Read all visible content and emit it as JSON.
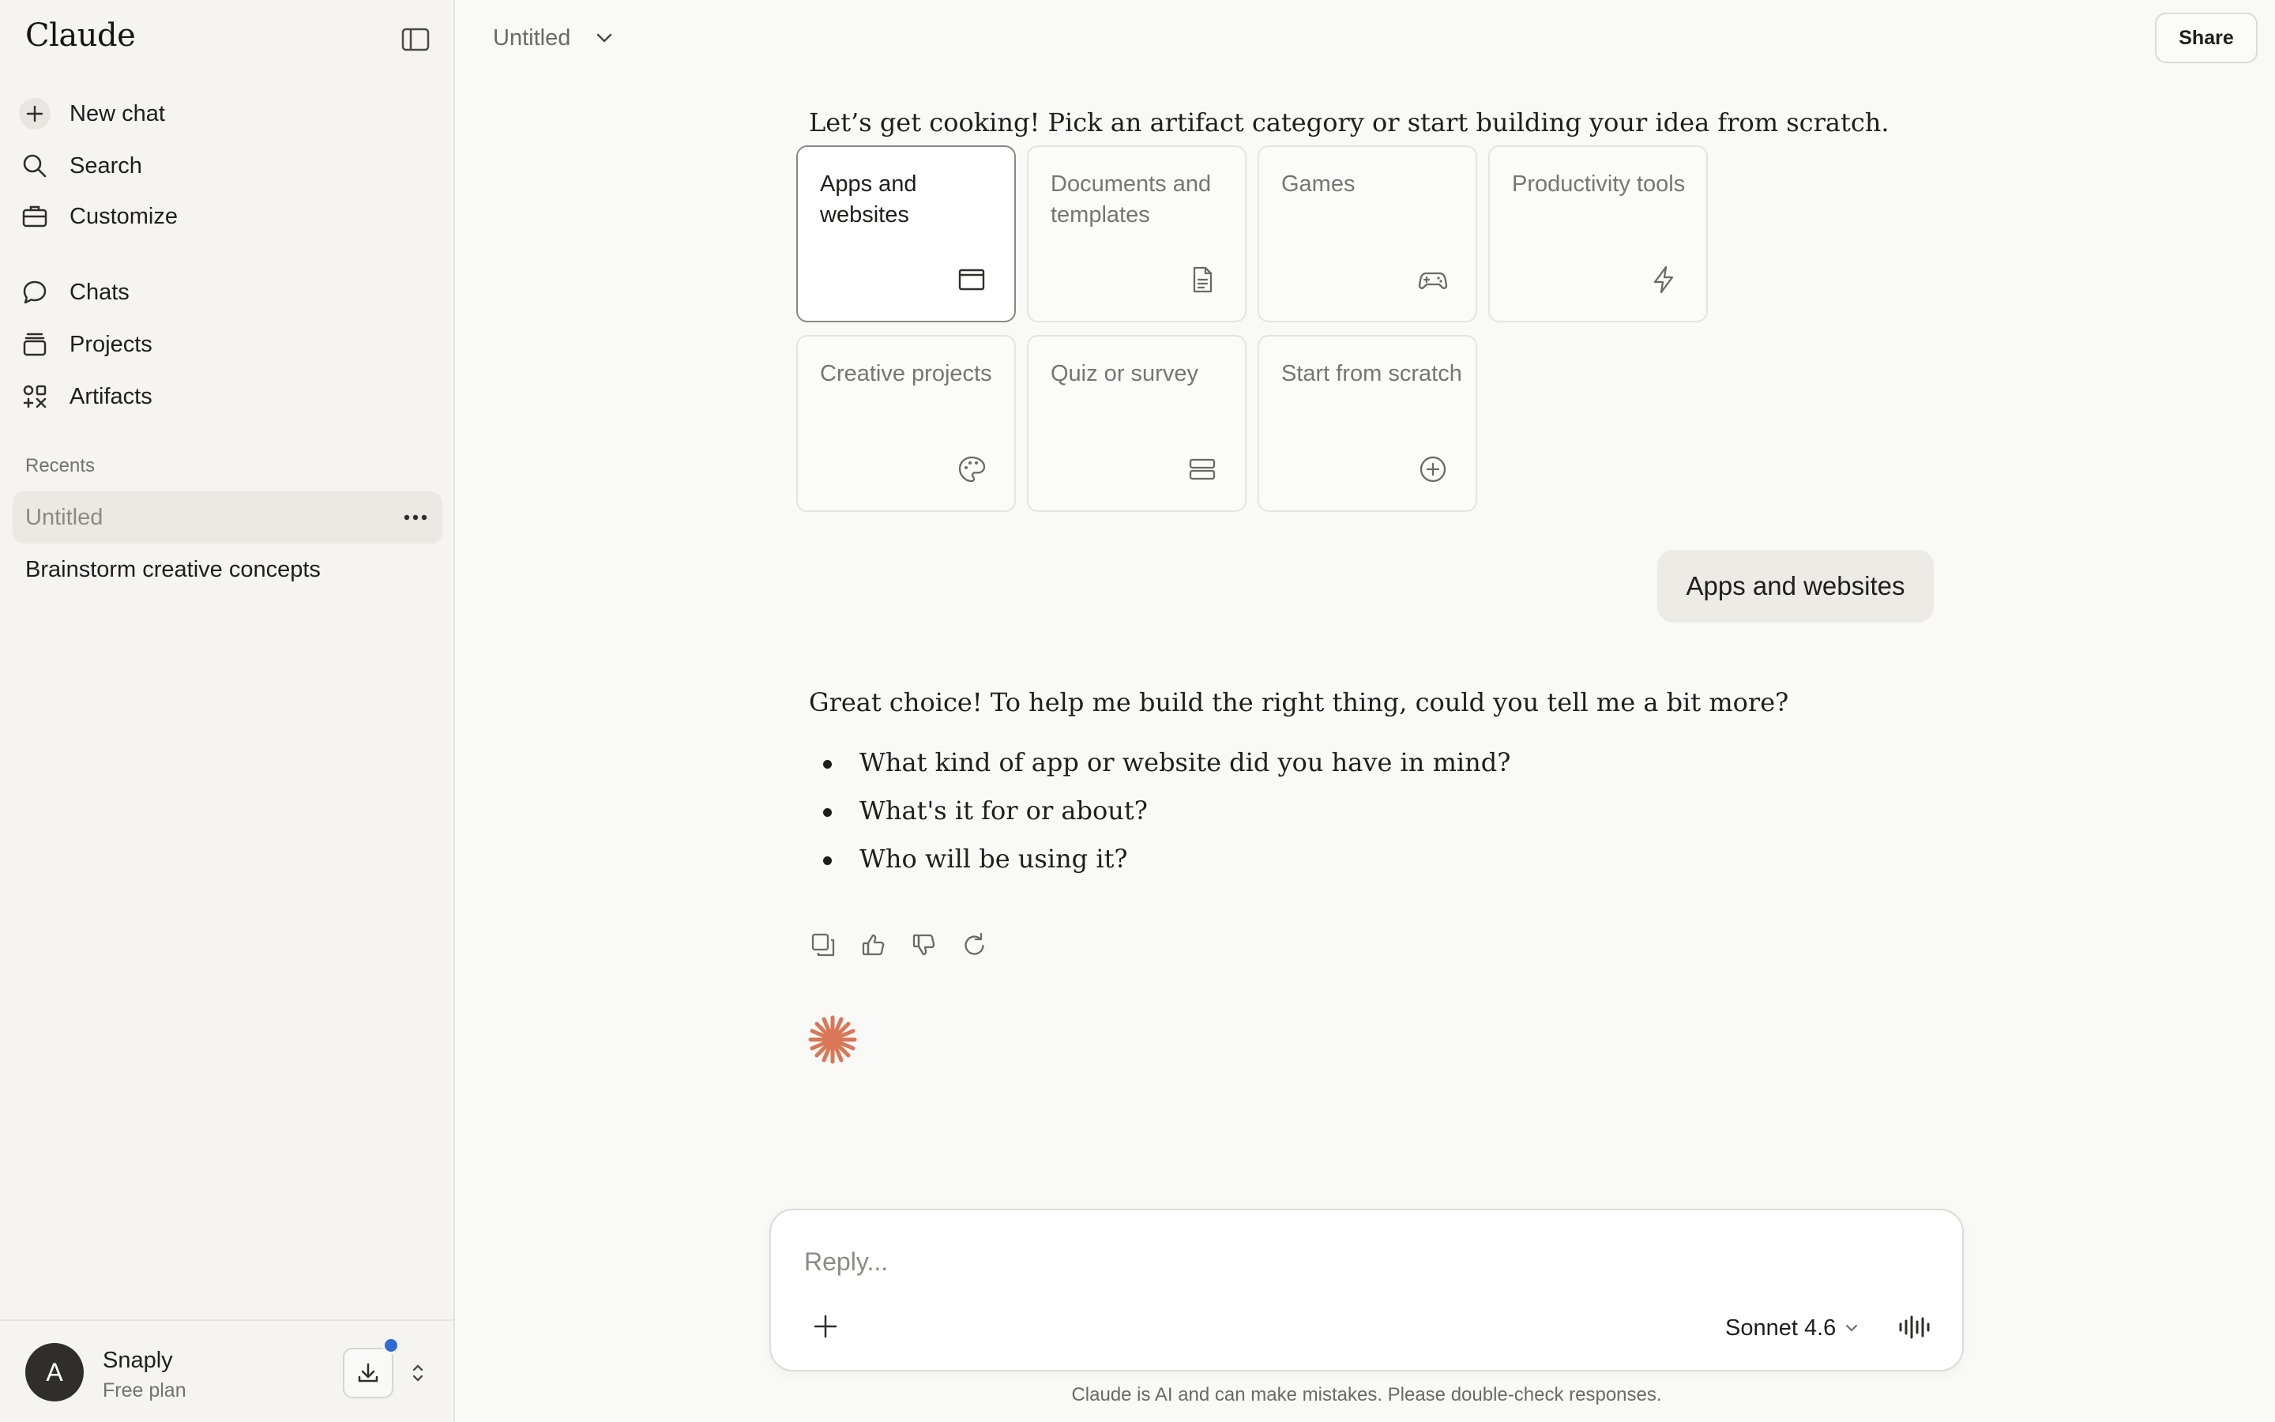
{
  "app": {
    "name": "Claude"
  },
  "sidebar": {
    "nav": [
      {
        "label": "New chat",
        "icon": "plus-icon"
      },
      {
        "label": "Search",
        "icon": "search-icon"
      },
      {
        "label": "Customize",
        "icon": "briefcase-icon"
      },
      {
        "label": "Chats",
        "icon": "chat-bubble-icon"
      },
      {
        "label": "Projects",
        "icon": "folder-stack-icon"
      },
      {
        "label": "Artifacts",
        "icon": "artifacts-grid-icon"
      }
    ],
    "recents_heading": "Recents",
    "recents": [
      {
        "label": "Untitled",
        "active": true
      },
      {
        "label": "Brainstorm creative concepts",
        "active": false
      }
    ],
    "account": {
      "avatar_initial": "A",
      "name": "Snaply",
      "plan": "Free plan"
    }
  },
  "header": {
    "title": "Untitled",
    "share_label": "Share"
  },
  "conversation": {
    "intro": "Let’s get cooking! Pick an artifact category or start building your idea from scratch.",
    "categories": [
      {
        "label": "Apps and websites",
        "icon": "browser-window-icon",
        "selected": true
      },
      {
        "label": "Documents and templates",
        "icon": "document-icon",
        "selected": false
      },
      {
        "label": "Games",
        "icon": "gamepad-icon",
        "selected": false
      },
      {
        "label": "Productivity tools",
        "icon": "lightning-icon",
        "selected": false
      },
      {
        "label": "Creative projects",
        "icon": "palette-icon",
        "selected": false
      },
      {
        "label": "Quiz or survey",
        "icon": "list-rows-icon",
        "selected": false
      },
      {
        "label": "Start from scratch",
        "icon": "plus-circle-icon",
        "selected": false
      }
    ],
    "user_message": "Apps and websites",
    "assistant_message": {
      "lead": "Great choice! To help me build the right thing, could you tell me a bit more?",
      "bullets": [
        "What kind of app or website did you have in mind?",
        "What's it for or about?",
        "Who will be using it?"
      ]
    },
    "actions": [
      "copy-icon",
      "thumbs-up-icon",
      "thumbs-down-icon",
      "retry-icon"
    ]
  },
  "composer": {
    "placeholder": "Reply...",
    "model": "Sonnet 4.6"
  },
  "footer": {
    "disclaimer": "Claude is AI and can make mistakes. Please double-check responses."
  },
  "colors": {
    "accent": "#d97757",
    "notification": "#2f6bd6",
    "background": "#f9f9f7",
    "sidebar": "#f5f4f1"
  }
}
